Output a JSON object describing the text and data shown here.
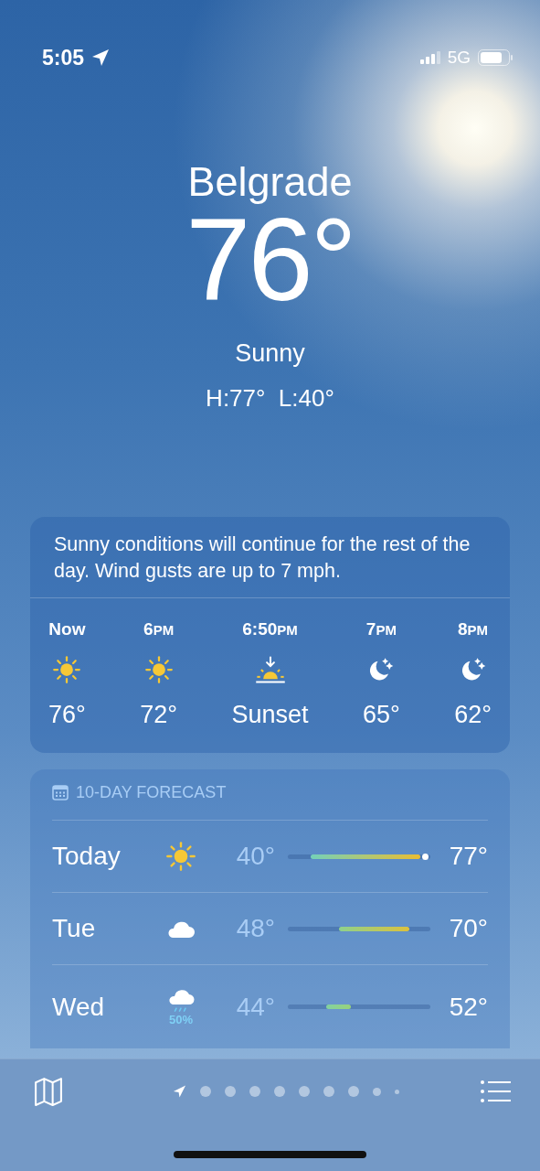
{
  "status_bar": {
    "time": "5:05",
    "network": "5G"
  },
  "header": {
    "city": "Belgrade",
    "temperature": "76°",
    "condition": "Sunny",
    "high_low": "H:77°  L:40°"
  },
  "hourly": {
    "summary": "Sunny conditions will continue for the rest of the day. Wind gusts are up to 7 mph.",
    "hours": [
      {
        "time": "Now",
        "kind": "sun",
        "value": "76°"
      },
      {
        "time": "6",
        "suffix": "PM",
        "kind": "sun",
        "value": "72°"
      },
      {
        "time": "6:50",
        "suffix": "PM",
        "kind": "sunset",
        "value": "Sunset"
      },
      {
        "time": "7",
        "suffix": "PM",
        "kind": "moon",
        "value": "65°"
      },
      {
        "time": "8",
        "suffix": "PM",
        "kind": "moon",
        "value": "62°"
      }
    ]
  },
  "forecast": {
    "title": "10-DAY FORECAST",
    "days": [
      {
        "day": "Today",
        "kind": "sun",
        "low": "40°",
        "high": "77°",
        "current": {
          "level": 0.96
        }
      },
      {
        "day": "Tue",
        "kind": "cloud",
        "low": "48°",
        "high": "70°"
      },
      {
        "day": "Wed",
        "kind": "rain",
        "chance": "50%",
        "low": "44°",
        "high": "52°"
      }
    ]
  },
  "toolbar": {
    "pages": [
      {
        "kind": "location",
        "selected": true
      },
      {
        "kind": "dot",
        "selected": false
      },
      {
        "kind": "dot",
        "selected": false
      },
      {
        "kind": "dot",
        "selected": false
      },
      {
        "kind": "dot",
        "selected": false
      },
      {
        "kind": "dot",
        "selected": false
      },
      {
        "kind": "dot",
        "selected": false
      },
      {
        "kind": "dot",
        "selected": false
      },
      {
        "kind": "small-dot",
        "selected": false
      },
      {
        "kind": "tiny-dot",
        "selected": false
      }
    ]
  }
}
